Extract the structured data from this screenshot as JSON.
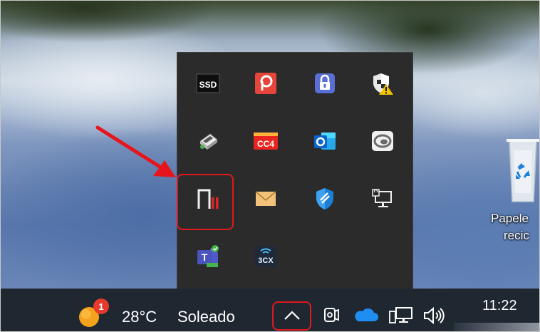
{
  "desktop": {
    "recycle_bin": {
      "label_line1": "Papele",
      "label_line2": "recic",
      "icon": "recycle-bin-icon"
    }
  },
  "tray_overflow": {
    "icons": [
      {
        "name": "ssd-utility-icon",
        "text": "SSD"
      },
      {
        "name": "presentation-app-icon"
      },
      {
        "name": "vpn-lock-icon"
      },
      {
        "name": "security-warning-shield-icon"
      },
      {
        "name": "printer-drive-icon"
      },
      {
        "name": "cc4-app-icon",
        "text": "CC4"
      },
      {
        "name": "outlook-icon"
      },
      {
        "name": "webcam-app-icon"
      },
      {
        "name": "parallels-bars-icon"
      },
      {
        "name": "mail-envelope-icon"
      },
      {
        "name": "defender-shield-icon"
      },
      {
        "name": "network-monitor-icon"
      },
      {
        "name": "teams-icon"
      },
      {
        "name": "3cx-phone-icon",
        "text": "3CX"
      }
    ]
  },
  "taskbar": {
    "weather": {
      "badge": "1",
      "temperature": "28°C",
      "condition": "Soleado"
    },
    "clock": {
      "time": "11:22"
    }
  },
  "colors": {
    "highlight": "#e0191f",
    "taskbar": "#1f2731",
    "flyout": "#2b2b2b"
  }
}
